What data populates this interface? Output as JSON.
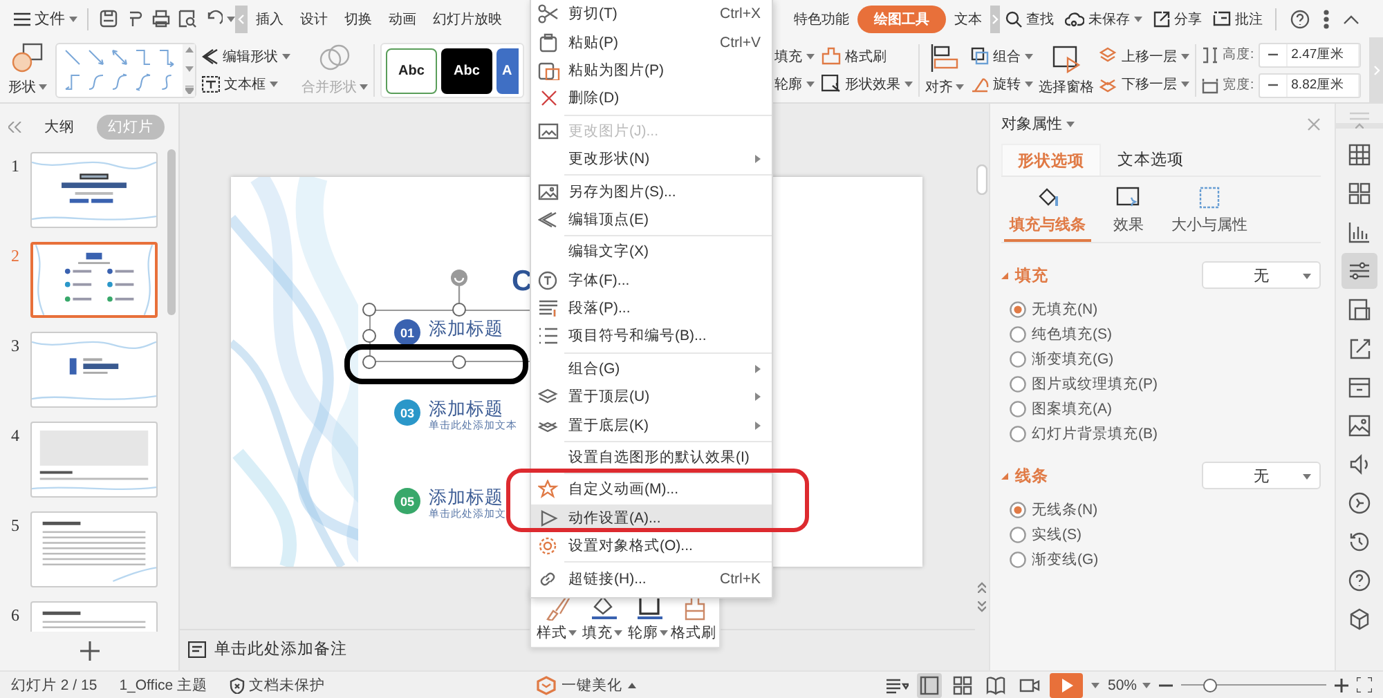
{
  "title_bar": {
    "file_menu": "文件",
    "tabs_left": [
      {
        "label": "插入",
        "selected": false
      },
      {
        "label": "设计",
        "selected": false
      },
      {
        "label": "切换",
        "selected": false
      },
      {
        "label": "动画",
        "selected": false
      },
      {
        "label": "幻灯片放映",
        "selected": false
      }
    ],
    "tabs_right": [
      {
        "label": "特色功能",
        "selected": false
      },
      {
        "label": "绘图工具",
        "selected": true
      },
      {
        "label": "文本",
        "selected": false
      }
    ],
    "search": "查找",
    "save_status": "未保存",
    "share": "分享",
    "comment": "批注"
  },
  "ribbon": {
    "shape": "形状",
    "edit_shape": "编辑形状",
    "text_box": "文本框",
    "merge_shape": {
      "label": "合并形状",
      "disabled": true
    },
    "style_swatches": [
      {
        "label": "Abc",
        "kind": "outline"
      },
      {
        "label": "Abc",
        "kind": "dark"
      },
      {
        "label": "A",
        "kind": "accent"
      }
    ],
    "fill": "填充",
    "outline": "轮廓",
    "format_painter": "格式刷",
    "shape_effect": "形状效果",
    "align": "对齐",
    "group": "组合",
    "rotate": "旋转",
    "selection_pane": "选择窗格",
    "bring_forward": "上移一层",
    "send_backward": "下移一层",
    "height": {
      "label": "高度:",
      "value": "2.47厘米"
    },
    "width": {
      "label": "宽度:",
      "value": "8.82厘米"
    }
  },
  "slides_panel": {
    "tabs": [
      {
        "label": "大纲",
        "selected": false
      },
      {
        "label": "幻灯片",
        "selected": true
      }
    ],
    "thumbnails": [
      {
        "number": "1",
        "kind": "title",
        "selected": false
      },
      {
        "number": "2",
        "kind": "contents",
        "selected": true
      },
      {
        "number": "3",
        "kind": "section",
        "selected": false
      },
      {
        "number": "4",
        "kind": "photo",
        "selected": false
      },
      {
        "number": "5",
        "kind": "text",
        "selected": false
      },
      {
        "number": "6",
        "kind": "text",
        "selected": false
      }
    ]
  },
  "slide": {
    "heading": "C",
    "items": [
      {
        "number": "01",
        "title": "添加标题",
        "color": "#3a62b0",
        "selected": true
      },
      {
        "number": "03",
        "title": "添加标题",
        "subtitle": "单击此处添加文本",
        "color": "#2b97c9",
        "selected": false
      },
      {
        "number": "05",
        "title": "添加标题",
        "subtitle": "单击此处添加文",
        "color": "#38a86a",
        "selected": false
      }
    ]
  },
  "notes_prompt": "单击此处添加备注",
  "float_toolbar": [
    {
      "label": "样式",
      "has_menu": true
    },
    {
      "label": "填充",
      "has_menu": true
    },
    {
      "label": "轮廓",
      "has_menu": true
    },
    {
      "label": "格式刷",
      "has_menu": false
    }
  ],
  "context_menu": [
    {
      "kind": "item",
      "label": "剪切(T)",
      "shortcut": "Ctrl+X",
      "disabled": false,
      "submenu": false,
      "highlighted": false
    },
    {
      "kind": "item",
      "label": "粘贴(P)",
      "shortcut": "Ctrl+V",
      "disabled": false,
      "submenu": false,
      "highlighted": false
    },
    {
      "kind": "item",
      "label": "粘贴为图片(P)",
      "disabled": false,
      "submenu": false,
      "highlighted": false
    },
    {
      "kind": "item",
      "label": "删除(D)",
      "disabled": false,
      "submenu": false,
      "highlighted": false
    },
    {
      "kind": "separator"
    },
    {
      "kind": "item",
      "label": "更改图片(J)...",
      "disabled": true,
      "submenu": false,
      "highlighted": false
    },
    {
      "kind": "item",
      "label": "更改形状(N)",
      "disabled": false,
      "submenu": true,
      "highlighted": false
    },
    {
      "kind": "separator"
    },
    {
      "kind": "item",
      "label": "另存为图片(S)...",
      "disabled": false,
      "submenu": false,
      "highlighted": false
    },
    {
      "kind": "item",
      "label": "编辑顶点(E)",
      "disabled": false,
      "submenu": false,
      "highlighted": false
    },
    {
      "kind": "separator"
    },
    {
      "kind": "item",
      "label": "编辑文字(X)",
      "disabled": false,
      "submenu": false,
      "highlighted": false
    },
    {
      "kind": "item",
      "label": "字体(F)...",
      "disabled": false,
      "submenu": false,
      "highlighted": false
    },
    {
      "kind": "item",
      "label": "段落(P)...",
      "disabled": false,
      "submenu": false,
      "highlighted": false
    },
    {
      "kind": "item",
      "label": "项目符号和编号(B)...",
      "disabled": false,
      "submenu": false,
      "highlighted": false
    },
    {
      "kind": "separator"
    },
    {
      "kind": "item",
      "label": "组合(G)",
      "disabled": false,
      "submenu": true,
      "highlighted": false
    },
    {
      "kind": "item",
      "label": "置于顶层(U)",
      "disabled": false,
      "submenu": true,
      "highlighted": false
    },
    {
      "kind": "item",
      "label": "置于底层(K)",
      "disabled": false,
      "submenu": true,
      "highlighted": false
    },
    {
      "kind": "separator"
    },
    {
      "kind": "item",
      "label": "设置自选图形的默认效果(I)",
      "disabled": false,
      "submenu": false,
      "highlighted": false
    },
    {
      "kind": "separator"
    },
    {
      "kind": "item",
      "label": "自定义动画(M)...",
      "disabled": false,
      "submenu": false,
      "highlighted": false
    },
    {
      "kind": "item",
      "label": "动作设置(A)...",
      "disabled": false,
      "submenu": false,
      "highlighted": true
    },
    {
      "kind": "item",
      "label": "设置对象格式(O)...",
      "disabled": false,
      "submenu": false,
      "highlighted": false
    },
    {
      "kind": "separator"
    },
    {
      "kind": "item",
      "label": "超链接(H)...",
      "shortcut": "Ctrl+K",
      "disabled": false,
      "submenu": false,
      "highlighted": false
    }
  ],
  "properties_panel": {
    "title": "对象属性",
    "tabs": [
      {
        "label": "形状选项",
        "selected": true
      },
      {
        "label": "文本选项",
        "selected": false
      }
    ],
    "subtabs": [
      {
        "label": "填充与线条",
        "selected": true
      },
      {
        "label": "效果",
        "selected": false
      },
      {
        "label": "大小与属性",
        "selected": false
      }
    ],
    "sections": [
      {
        "title": "填充",
        "expanded": true,
        "dropdown": "无",
        "options": [
          {
            "label": "无填充(N)",
            "selected": true
          },
          {
            "label": "纯色填充(S)",
            "selected": false
          },
          {
            "label": "渐变填充(G)",
            "selected": false
          },
          {
            "label": "图片或纹理填充(P)",
            "selected": false
          },
          {
            "label": "图案填充(A)",
            "selected": false
          },
          {
            "label": "幻灯片背景填充(B)",
            "selected": false
          }
        ]
      },
      {
        "title": "线条",
        "expanded": true,
        "dropdown": "无",
        "options": [
          {
            "label": "无线条(N)",
            "selected": true
          },
          {
            "label": "实线(S)",
            "selected": false
          },
          {
            "label": "渐变线(G)",
            "selected": false
          }
        ]
      }
    ]
  },
  "side_tools": [
    {
      "selected": false
    },
    {
      "selected": false
    },
    {
      "selected": false
    },
    {
      "selected": true
    },
    {
      "selected": false
    },
    {
      "selected": false
    },
    {
      "selected": false
    },
    {
      "selected": false
    },
    {
      "selected": false
    },
    {
      "selected": false
    },
    {
      "selected": false
    },
    {
      "selected": false
    },
    {
      "selected": false
    }
  ],
  "status_bar": {
    "slide_indicator": "幻灯片 2 / 15",
    "theme": "1_Office 主题",
    "protection": "文档未保护",
    "beautify": "一键美化",
    "views": [
      {
        "selected": true
      },
      {
        "selected": false
      },
      {
        "selected": false
      },
      {
        "selected": false
      }
    ],
    "zoom": "50%",
    "zoom_slider": {
      "level": 0.2
    }
  }
}
